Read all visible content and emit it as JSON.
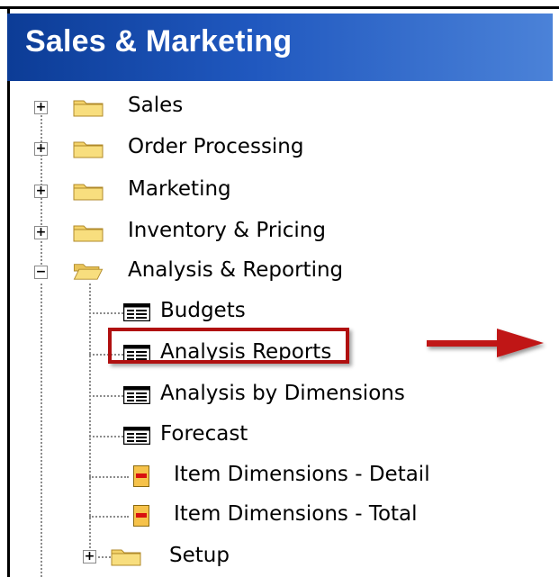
{
  "header": {
    "title": "Sales & Marketing"
  },
  "tree": {
    "items": [
      {
        "label": "Sales",
        "type": "folder",
        "expanded": false
      },
      {
        "label": "Order Processing",
        "type": "folder",
        "expanded": false
      },
      {
        "label": "Marketing",
        "type": "folder",
        "expanded": false
      },
      {
        "label": "Inventory & Pricing",
        "type": "folder",
        "expanded": false
      },
      {
        "label": "Analysis & Reporting",
        "type": "folder-open",
        "expanded": true,
        "children": [
          {
            "label": "Budgets",
            "type": "form"
          },
          {
            "label": "Analysis Reports",
            "type": "form",
            "highlighted": true
          },
          {
            "label": "Analysis by Dimensions",
            "type": "form"
          },
          {
            "label": "Forecast",
            "type": "form"
          },
          {
            "label": "Item Dimensions - Detail",
            "type": "report"
          },
          {
            "label": "Item Dimensions - Total",
            "type": "report"
          },
          {
            "label": "Setup",
            "type": "folder",
            "expanded": false
          }
        ]
      }
    ]
  },
  "colors": {
    "header_start": "#0c3c96",
    "header_end": "#4b82d8",
    "highlight": "#b01010",
    "arrow": "#c01818"
  }
}
